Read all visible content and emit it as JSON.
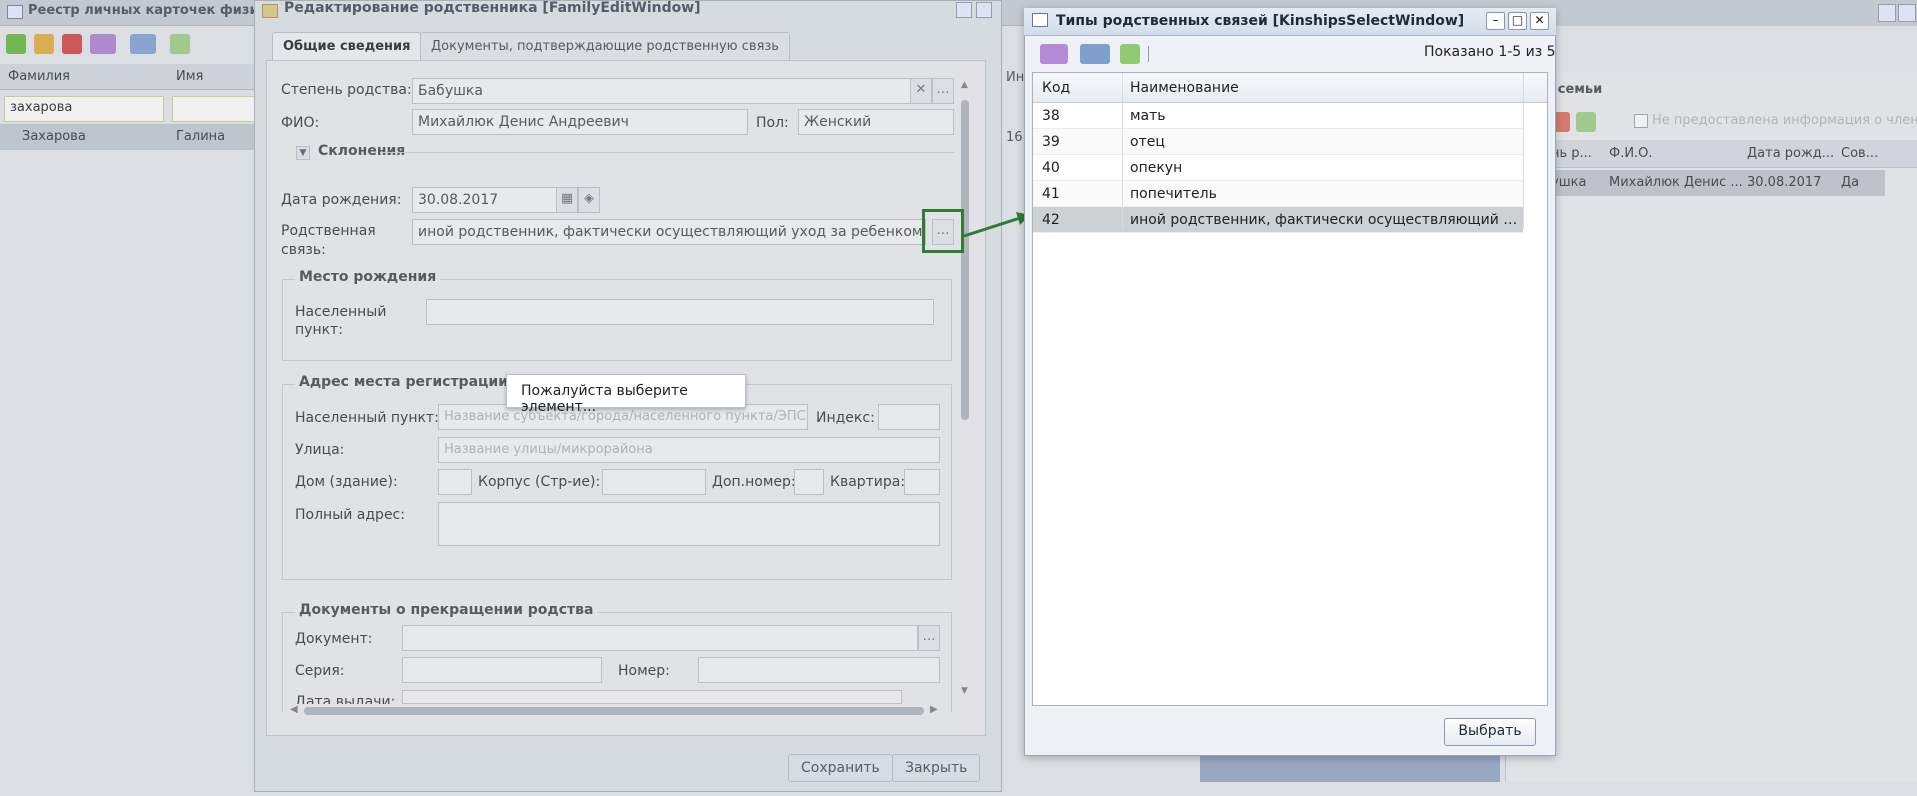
{
  "background_registry": {
    "title": "Реестр личных карточек физич",
    "columns": [
      "Фамилия",
      "Имя"
    ],
    "filter_value": "захарова",
    "row": {
      "surname": "Захарова",
      "name": "Галина"
    },
    "side_text": "Ин",
    "side_number": "16:"
  },
  "family_panel": {
    "title": "в семьи",
    "checkbox_label": "Не предоставлена информация о члена",
    "columns": [
      "ень р...",
      "Ф.И.О.",
      "Дата рожд...",
      "Сов..."
    ],
    "row": [
      "бушка",
      "Михайлюк Денис ...",
      "30.08.2017",
      "Да"
    ]
  },
  "edit_window": {
    "title": "Редактирование родственника [FamilyEditWindow]",
    "tabs": [
      "Общие сведения",
      "Документы, подтверждающие родственную связь"
    ],
    "fields": {
      "degree_label": "Степень родства:",
      "degree_value": "Бабушка",
      "fio_label": "ФИО:",
      "fio_value": "Михайлюк Денис Андреевич",
      "gender_label": "Пол:",
      "gender_value": "Женский",
      "declensions_label": "Склонения",
      "birthdate_label": "Дата рождения:",
      "birthdate_value": "30.08.2017",
      "kinship_label_1": "Родственная",
      "kinship_label_2": "связь:",
      "kinship_value": "иной родственник, фактически осуществляющий уход за ребенком"
    },
    "birthplace": {
      "title": "Место рождения",
      "locality_label_1": "Населенный",
      "locality_label_2": "пункт:"
    },
    "registration": {
      "title": "Адрес места регистрации",
      "locality_label": "Населенный пункт:",
      "locality_placeholder": "Название субъекта/города/населенного пункта/ЭПС",
      "index_label": "Индекс:",
      "street_label": "Улица:",
      "street_placeholder": "Название улицы/микрорайона",
      "house_label": "Дом (здание):",
      "building_label": "Корпус (Стр-ие):",
      "extra_label": "Доп.номер:",
      "apartment_label": "Квартира:",
      "full_address_label": "Полный адрес:"
    },
    "termination": {
      "title": "Документы о прекращении родства",
      "document_label": "Документ:",
      "series_label": "Серия:",
      "number_label": "Номер:",
      "issue_date_label": "Дата выдачи:"
    },
    "buttons": {
      "save": "Сохранить",
      "close": "Закрыть"
    }
  },
  "tooltip": {
    "text": "Пожалуйста выберите элемент..."
  },
  "kinships_window": {
    "title": "Типы родственных связей [KinshipsSelectWindow]",
    "count_text": "Показано 1-5 из 5",
    "columns": {
      "code": "Код",
      "name": "Наименование"
    },
    "rows": [
      {
        "code": "38",
        "name": "мать"
      },
      {
        "code": "39",
        "name": "отец"
      },
      {
        "code": "40",
        "name": "опекун"
      },
      {
        "code": "41",
        "name": "попечитель"
      },
      {
        "code": "42",
        "name": "иной родственник, фактически осуществляющий уход за р..."
      }
    ],
    "selected_index": 4,
    "select_button": "Выбрать"
  },
  "colors": {
    "highlight": "#2e7d32",
    "selected_row": "#cdd1d6"
  }
}
